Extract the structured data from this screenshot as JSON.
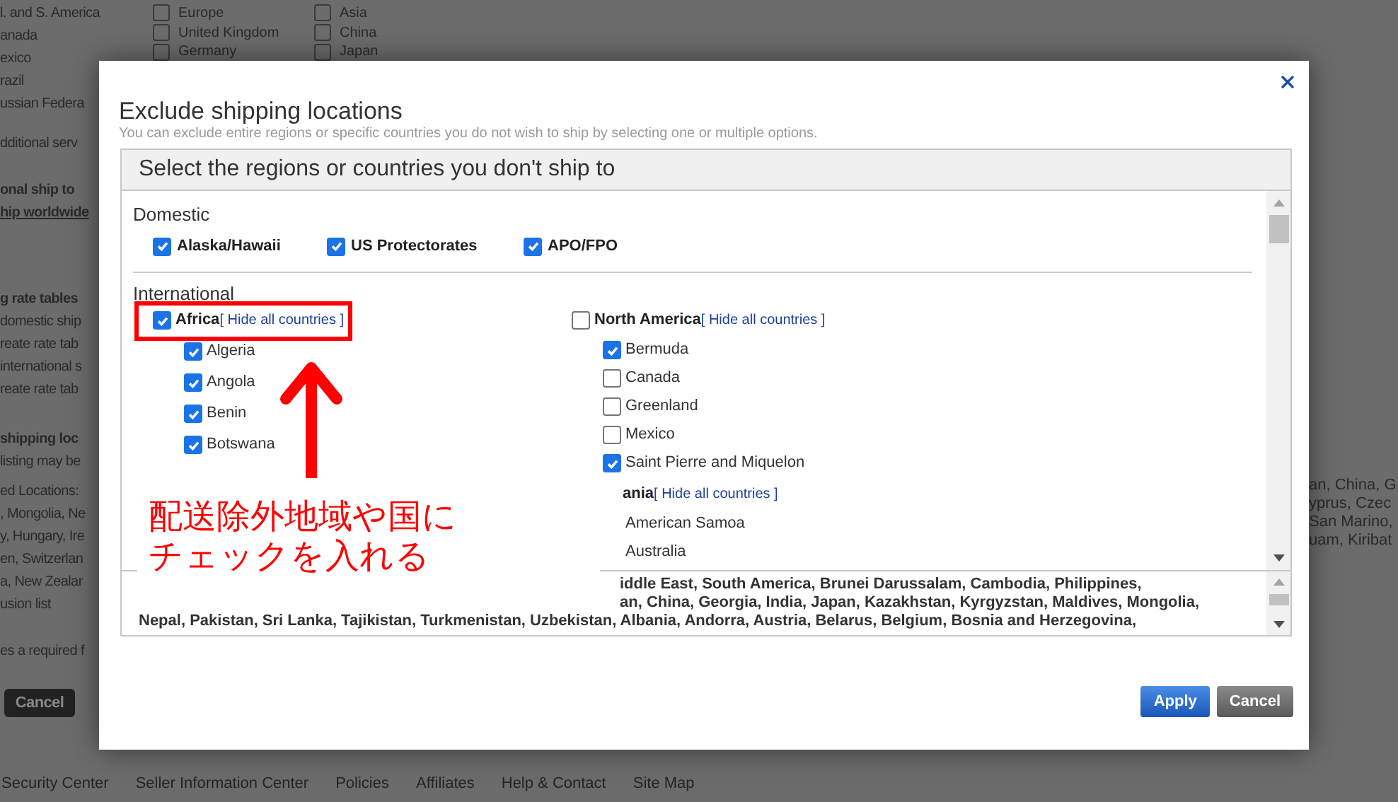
{
  "background_page": {
    "regions": [
      {
        "label": "Europe",
        "checked": false
      },
      {
        "label": "United Kingdom",
        "checked": false
      },
      {
        "label": "Germany",
        "checked": false
      },
      {
        "label": "Asia",
        "checked": false
      },
      {
        "label": "China",
        "checked": false
      },
      {
        "label": "Japan",
        "checked": false
      }
    ],
    "left_sections": [
      {
        "lines": [
          {
            "kind": "text",
            "text": "l. and S. America"
          },
          {
            "kind": "text",
            "text": "anada"
          },
          {
            "kind": "text",
            "text": "exico"
          },
          {
            "kind": "text",
            "text": "razil"
          },
          {
            "kind": "text",
            "text": "ussian Federa"
          }
        ]
      },
      {
        "lines": [
          {
            "kind": "text",
            "text": "dditional serv"
          }
        ]
      },
      {
        "lines": [
          {
            "kind": "heading",
            "text": "onal ship to"
          },
          {
            "kind": "link",
            "text": "hip worldwide"
          }
        ]
      },
      {
        "lines": [
          {
            "kind": "heading",
            "text": "g rate tables"
          },
          {
            "kind": "text",
            "text": "domestic ship"
          },
          {
            "kind": "text",
            "text": "reate rate tab"
          },
          {
            "kind": "text",
            "text": "international s"
          },
          {
            "kind": "text",
            "text": "reate rate tab"
          }
        ]
      },
      {
        "lines": [
          {
            "kind": "heading",
            "text": "shipping loc"
          },
          {
            "kind": "text",
            "text": "listing may be"
          }
        ]
      },
      {
        "lines": [
          {
            "kind": "text",
            "text": "ed Locations:"
          },
          {
            "kind": "text",
            "text": ", Mongolia, Ne"
          },
          {
            "kind": "text",
            "text": "y, Hungary, Ire"
          },
          {
            "kind": "text",
            "text": "en, Switzerlan"
          },
          {
            "kind": "text",
            "text": "a, New Zealar"
          },
          {
            "kind": "text",
            "text": "usion list"
          }
        ]
      },
      {
        "lines": [
          {
            "kind": "text",
            "text": "es a required f"
          }
        ]
      }
    ],
    "cancel_button": "Cancel",
    "right_lines": [
      "an, China, G",
      "yprus, Czec",
      "San Marino,",
      "uam, Kiribat"
    ],
    "footer_links": [
      "Security Center",
      "Seller Information Center",
      "Policies",
      "Affiliates",
      "Help & Contact",
      "Site Map"
    ]
  },
  "dialog": {
    "title": "Exclude shipping locations",
    "subtitle": "You can exclude entire regions or specific countries you do not wish to ship by selecting one or multiple options.",
    "panel_title": "Select the regions or countries you don't ship to",
    "domestic": {
      "heading": "Domestic",
      "options": [
        {
          "label": "Alaska/Hawaii",
          "checked": true
        },
        {
          "label": "US Protectorates",
          "checked": true
        },
        {
          "label": "APO/FPO",
          "checked": true
        }
      ]
    },
    "international": {
      "heading": "International",
      "columns": [
        [
          {
            "label": "Africa",
            "checked": true,
            "link": "[ Hide all countries ]",
            "countries": [
              {
                "label": "Algeria",
                "checked": true
              },
              {
                "label": "Angola",
                "checked": true
              },
              {
                "label": "Benin",
                "checked": true
              },
              {
                "label": "Botswana",
                "checked": true
              }
            ]
          }
        ],
        [
          {
            "label": "North America",
            "checked": false,
            "link": "[ Hide all countries ]",
            "countries": [
              {
                "label": "Bermuda",
                "checked": true
              },
              {
                "label": "Canada",
                "checked": false
              },
              {
                "label": "Greenland",
                "checked": false
              },
              {
                "label": "Mexico",
                "checked": false
              },
              {
                "label": "Saint Pierre and Miquelon",
                "checked": true
              }
            ]
          },
          {
            "label": "ania",
            "link": "[ Hide all countries ]",
            "countries": [
              {
                "label": "American Samoa"
              },
              {
                "label": "Australia"
              }
            ]
          }
        ]
      ]
    },
    "summary_lines": [
      "iddle East, South America, Brunei Darussalam, Cambodia, Philippines,",
      "an, China, Georgia, India, Japan, Kazakhstan, Kyrgyzstan, Maldives, Mongolia,",
      "Nepal, Pakistan, Sri Lanka, Tajikistan, Turkmenistan, Uzbekistan, Albania, Andorra, Austria, Belarus, Belgium, Bosnia and Herzegovina,"
    ],
    "buttons": [
      {
        "kind": "primary",
        "label": "Apply"
      },
      {
        "kind": "secondary",
        "label": "Cancel"
      }
    ]
  },
  "annotation": {
    "lines": [
      "配送除外地域や国に",
      "チェックを入れる"
    ]
  }
}
